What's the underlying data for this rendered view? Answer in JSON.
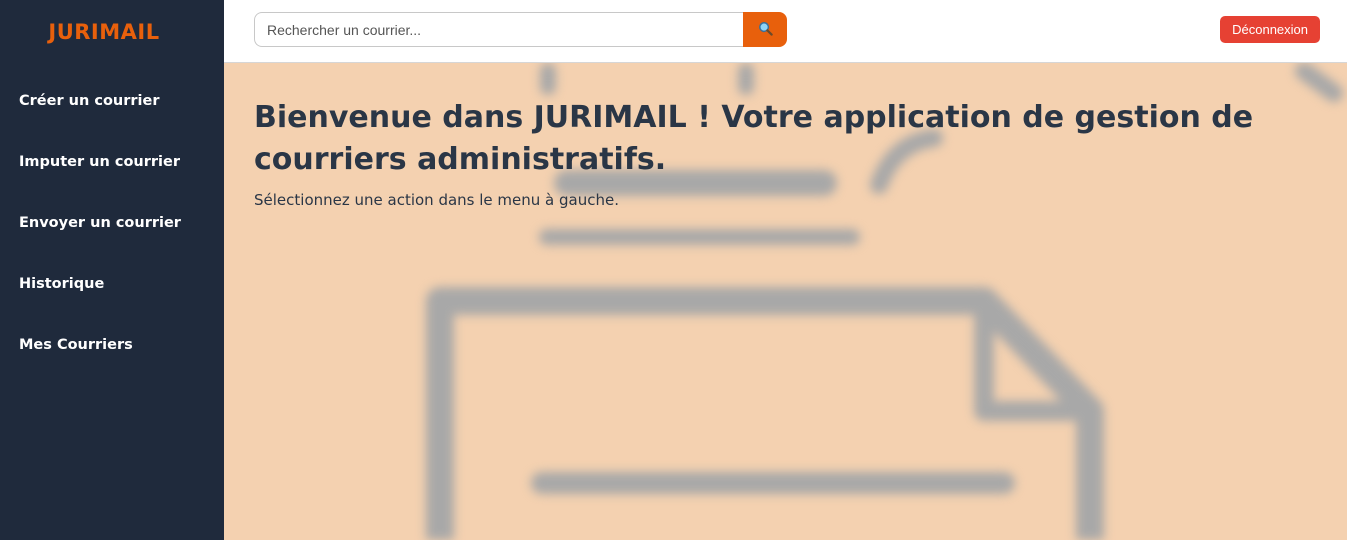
{
  "app": {
    "brand": "JURIMAIL"
  },
  "sidebar": {
    "items": [
      {
        "label": "Créer un courrier"
      },
      {
        "label": "Imputer un courrier"
      },
      {
        "label": "Envoyer un courrier"
      },
      {
        "label": "Historique"
      },
      {
        "label": "Mes Courriers"
      }
    ]
  },
  "header": {
    "search": {
      "placeholder": "Rechercher un courrier...",
      "value": "",
      "icon": "search-icon"
    },
    "logout_label": "Déconnexion"
  },
  "main": {
    "title": "Bienvenue dans JURIMAIL ! Votre application de gestion de courriers administratifs.",
    "subtitle": "Sélectionnez une action dans le menu à gauche.",
    "background_icon": "document-icon"
  },
  "colors": {
    "sidebar_bg": "#1f2a3c",
    "accent": "#e8600c",
    "logout": "#e64133",
    "main_bg": "#f4d1b0",
    "text_dark": "#2a3646"
  }
}
